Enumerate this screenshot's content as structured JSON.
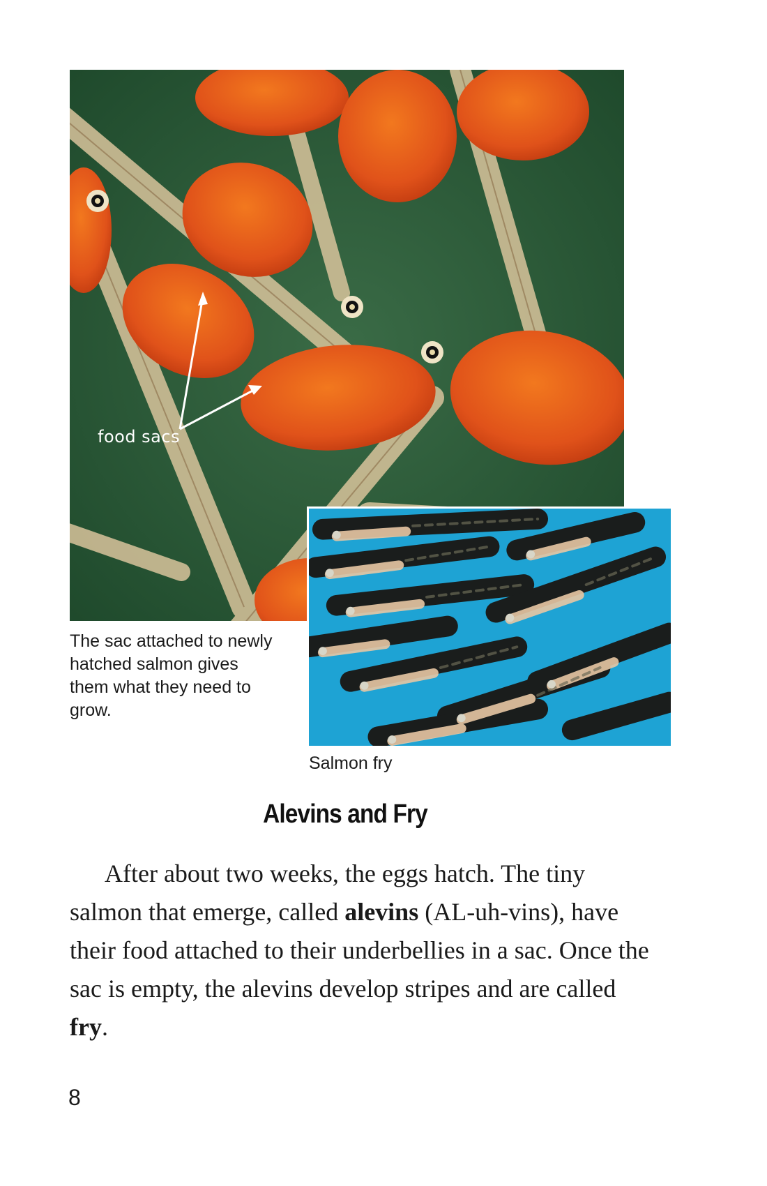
{
  "photo_alevins": {
    "label": "food sacs",
    "caption": "The sac attached to newly hatched salmon gives them what they need to grow."
  },
  "photo_fry": {
    "caption": "Salmon fry"
  },
  "section": {
    "heading": "Alevins and Fry",
    "body": {
      "part1": "After about two weeks, the eggs hatch. The tiny salmon that emerge, called ",
      "term1": "alevins",
      "part2": " (AL-uh-vins), have their food attached to their underbellies in a sac. Once the sac is empty, the alevins develop stripes and are called ",
      "term2": "fry",
      "part3": "."
    }
  },
  "page_number": "8",
  "colors": {
    "water_green": "#2f5a3a",
    "sac_orange": "#e0521a",
    "water_blue": "#1ea3d4"
  }
}
